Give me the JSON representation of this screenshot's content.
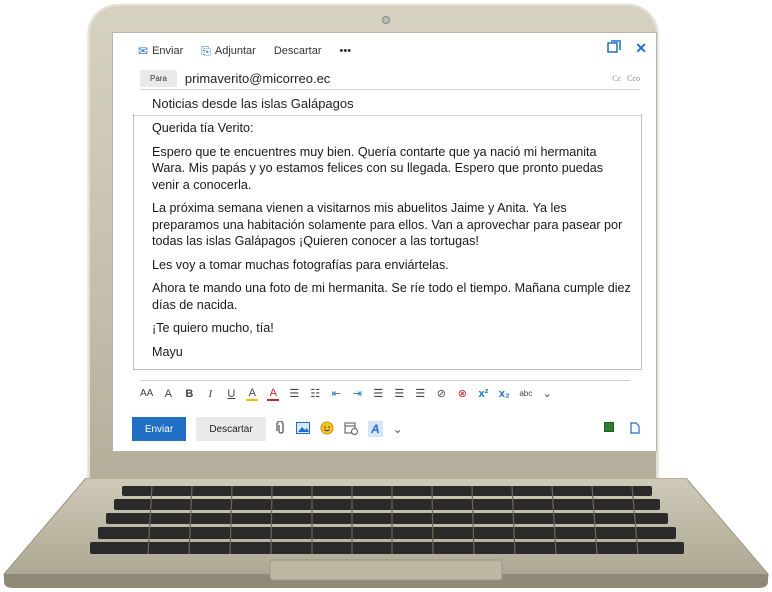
{
  "toolbar": {
    "send_label": "Enviar",
    "attach_label": "Adjuntar",
    "discard_label": "Descartar",
    "more_label": "•••"
  },
  "window_controls": {
    "popout_icon": "popout-icon",
    "close_icon": "close-icon"
  },
  "to_field": {
    "label": "Para",
    "value": "primaverito@micorreo.ec",
    "cc": "Cc",
    "bcc": "Cco"
  },
  "subject": "Noticias desde las islas Galápagos",
  "body": {
    "greeting": "Querida tía Verito:",
    "p1": "Espero que te encuentres muy bien. Quería contarte que ya nació mi hermanita Wara. Mis papás y yo estamos felices con su llegada. Espero que pronto puedas venir a conocerla.",
    "p2": "La próxima semana vienen a visitarnos mis abuelitos Jaime y Anita. Ya les preparamos una habitación solamente para ellos. Van a aprovechar para pasear por todas las islas Galápagos ¡Quieren conocer a las tortugas!",
    "p3": "Les voy a tomar muchas fotografías para enviártelas.",
    "p4": "Ahora te mando una foto de mi hermanita. Se ríe todo el tiempo. Mañana cumple diez días de nacida.",
    "closing": "¡Te quiero mucho, tía!",
    "signature": "Mayu"
  },
  "format_bar": {
    "font_size_down": "AA",
    "font_size_up": "A",
    "bold": "B",
    "italic": "I",
    "underline": "U",
    "highlight": "A",
    "font_color": "A",
    "bullets": "☰",
    "numbering": "☷",
    "outdent": "⇤",
    "indent": "⇥",
    "align_left": "☰",
    "align_center": "☰",
    "align_right": "☰",
    "link": "⊘",
    "unlink": "⊗",
    "superscript": "x²",
    "subscript": "x₂",
    "strikethrough": "abc",
    "more": "⌄"
  },
  "bottom_bar": {
    "send_label": "Enviar",
    "discard_label": "Descartar"
  },
  "colors": {
    "accent": "#1f6fc4",
    "red": "#c8282a"
  }
}
